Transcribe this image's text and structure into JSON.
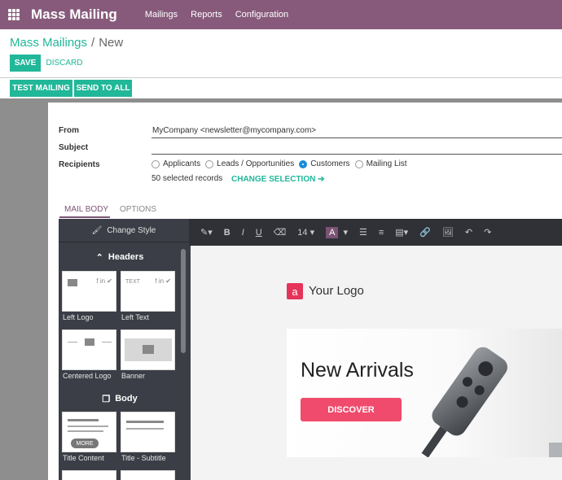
{
  "app": {
    "title": "Mass Mailing"
  },
  "topnav": [
    "Mailings",
    "Reports",
    "Configuration"
  ],
  "breadcrumb": {
    "parent": "Mass Mailings",
    "separator": "/",
    "current": "New"
  },
  "buttons": {
    "save": "SAVE",
    "discard": "DISCARD",
    "test_mailing": "TEST MAILING",
    "send_to_all": "SEND TO ALL"
  },
  "form": {
    "from_label": "From",
    "from_value": "MyCompany <newsletter@mycompany.com>",
    "subject_label": "Subject",
    "recipients_label": "Recipients",
    "recipient_options": [
      "Applicants",
      "Leads / Opportunities",
      "Customers",
      "Mailing List"
    ],
    "selected_recipient": "Customers",
    "selected_records": "50 selected records",
    "change_selection": "CHANGE SELECTION ➔"
  },
  "tabs": [
    "MAIL BODY",
    "OPTIONS"
  ],
  "editor": {
    "change_style": "Change Style",
    "font_size": "14",
    "color_letter": "A",
    "headers_label": "Headers",
    "body_label": "Body",
    "snippets": [
      "Left Logo",
      "Left Text",
      "Centered Logo",
      "Banner",
      "Title Content",
      "Title - Subtitle"
    ],
    "more_label": "MORE",
    "left_text_placeholder": "TEXT",
    "social_icons": "f in ✔"
  },
  "content": {
    "logo_letter": "a",
    "logo_text": "Your Logo",
    "banner_title": "New Arrivals",
    "banner_button": "DISCOVER"
  },
  "colors": {
    "brand": "#875a7b",
    "accent": "#21b799",
    "cta": "#f04b6c"
  }
}
